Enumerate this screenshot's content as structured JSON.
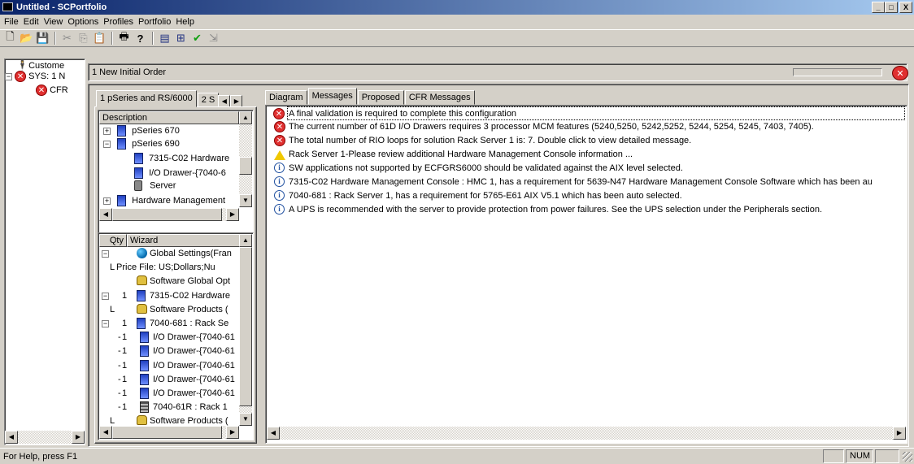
{
  "window": {
    "title": "Untitled - SCPortfolio",
    "buttons": [
      "_",
      "□",
      "X"
    ]
  },
  "menubar": [
    "File",
    "Edit",
    "View",
    "Options",
    "Profiles",
    "Portfolio",
    "Help"
  ],
  "toolbar": {
    "icons": [
      "new-icon",
      "open-icon",
      "save-icon",
      "cut-icon",
      "copy-icon",
      "paste-icon",
      "print-icon",
      "help-icon",
      "list-icon",
      "compare-icon",
      "validate-icon",
      "export-icon"
    ]
  },
  "left_tree": {
    "items": [
      {
        "label": "Custome",
        "icon": "person-icon"
      },
      {
        "label": "SYS: 1 N",
        "icon": "error-icon",
        "expand": "−"
      },
      {
        "label": "CFR",
        "icon": "error-icon"
      }
    ]
  },
  "order_bar": {
    "title": "1 New Initial Order"
  },
  "left_tabs": {
    "tab1": "1 pSeries and RS/6000",
    "tab2": "2 S"
  },
  "description": {
    "header": "Description",
    "items": [
      {
        "label": "pSeries 670",
        "expand": "+"
      },
      {
        "label": "pSeries 690",
        "expand": "−"
      },
      {
        "label": "7315-C02 Hardware"
      },
      {
        "label": "I/O Drawer-{7040-6"
      },
      {
        "label": "Server"
      },
      {
        "label": "Hardware Management",
        "expand": "+"
      }
    ]
  },
  "wizard": {
    "qty_header": "Qty",
    "wizard_header": "Wizard",
    "rows": [
      {
        "expand": "−",
        "qty": "",
        "label": "Global Settings(Fran",
        "icon": "globe-icon"
      },
      {
        "expand": "L",
        "qty": "",
        "label": "Price File: US;Dollars;Nu",
        "icon": ""
      },
      {
        "expand": "",
        "qty": "",
        "label": "Software Global Opt",
        "icon": "software-icon"
      },
      {
        "expand": "−",
        "qty": "1",
        "label": "7315-C02 Hardware",
        "icon": "server-icon"
      },
      {
        "expand": "L",
        "qty": "",
        "label": "Software Products (",
        "icon": "software-icon"
      },
      {
        "expand": "−",
        "qty": "1",
        "label": "7040-681 : Rack Se",
        "icon": "server-icon"
      },
      {
        "expand": "-",
        "qty": "1",
        "label": "I/O Drawer-{7040-61",
        "icon": "server-icon"
      },
      {
        "expand": "-",
        "qty": "1",
        "label": "I/O Drawer-{7040-61",
        "icon": "server-icon"
      },
      {
        "expand": "-",
        "qty": "1",
        "label": "I/O Drawer-{7040-61",
        "icon": "server-icon"
      },
      {
        "expand": "-",
        "qty": "1",
        "label": "I/O Drawer-{7040-61",
        "icon": "server-icon"
      },
      {
        "expand": "-",
        "qty": "1",
        "label": "I/O Drawer-{7040-61",
        "icon": "server-icon"
      },
      {
        "expand": "-",
        "qty": "1",
        "label": "7040-61R : Rack 1",
        "icon": "rack-icon"
      },
      {
        "expand": "L",
        "qty": "",
        "label": "Software Products (",
        "icon": "software-icon"
      }
    ]
  },
  "right_tabs": {
    "diagram": "Diagram",
    "messages": "Messages",
    "proposed": "Proposed",
    "cfr_messages": "CFR Messages"
  },
  "messages": [
    {
      "type": "error",
      "text": "A final validation is required to complete this configuration"
    },
    {
      "type": "error",
      "text": "The current number of 61D I/O Drawers requires 3 processor MCM features (5240,5250, 5242,5252, 5244, 5254, 5245, 7403, 7405)."
    },
    {
      "type": "error",
      "text": "The total number of RIO loops for solution Rack Server 1 is: 7. Double click to view detailed message."
    },
    {
      "type": "warning",
      "text": "Rack Server 1-Please review additional Hardware Management Console information ..."
    },
    {
      "type": "info",
      "text": "SW applications not supported by ECFGRS6000 should be validated against the AIX level selected."
    },
    {
      "type": "info",
      "text": "7315-C02 Hardware Management Console : HMC 1, has a requirement for 5639-N47 Hardware Management Console Software which has been au"
    },
    {
      "type": "info",
      "text": "7040-681 : Rack Server 1, has a requirement for 5765-E61 AIX V5.1 which has been auto selected."
    },
    {
      "type": "info",
      "text": "A UPS is recommended with the server to provide protection from power failures. See the UPS selection under the Peripherals section."
    }
  ],
  "statusbar": {
    "help": "For Help, press F1",
    "num": "NUM"
  }
}
